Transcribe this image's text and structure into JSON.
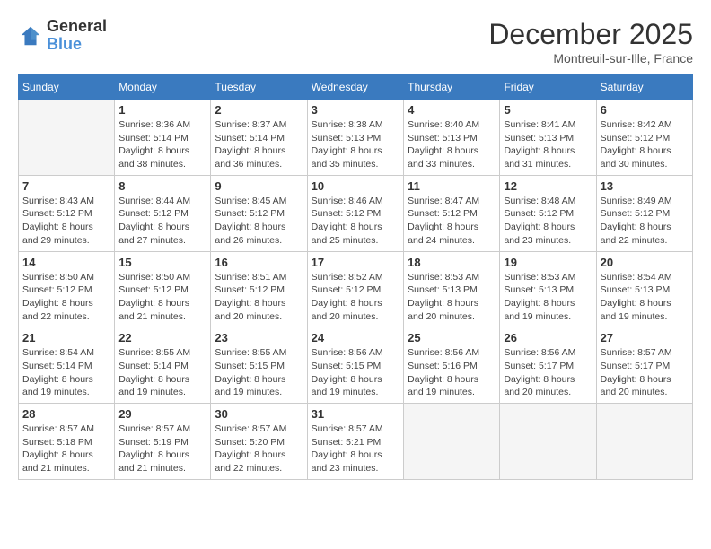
{
  "header": {
    "logo_general": "General",
    "logo_blue": "Blue",
    "month_year": "December 2025",
    "location": "Montreuil-sur-Ille, France"
  },
  "days_of_week": [
    "Sunday",
    "Monday",
    "Tuesday",
    "Wednesday",
    "Thursday",
    "Friday",
    "Saturday"
  ],
  "weeks": [
    [
      {
        "day": "",
        "sunrise": "",
        "sunset": "",
        "daylight": "",
        "empty": true
      },
      {
        "day": "1",
        "sunrise": "Sunrise: 8:36 AM",
        "sunset": "Sunset: 5:14 PM",
        "daylight": "Daylight: 8 hours and 38 minutes."
      },
      {
        "day": "2",
        "sunrise": "Sunrise: 8:37 AM",
        "sunset": "Sunset: 5:14 PM",
        "daylight": "Daylight: 8 hours and 36 minutes."
      },
      {
        "day": "3",
        "sunrise": "Sunrise: 8:38 AM",
        "sunset": "Sunset: 5:13 PM",
        "daylight": "Daylight: 8 hours and 35 minutes."
      },
      {
        "day": "4",
        "sunrise": "Sunrise: 8:40 AM",
        "sunset": "Sunset: 5:13 PM",
        "daylight": "Daylight: 8 hours and 33 minutes."
      },
      {
        "day": "5",
        "sunrise": "Sunrise: 8:41 AM",
        "sunset": "Sunset: 5:13 PM",
        "daylight": "Daylight: 8 hours and 31 minutes."
      },
      {
        "day": "6",
        "sunrise": "Sunrise: 8:42 AM",
        "sunset": "Sunset: 5:12 PM",
        "daylight": "Daylight: 8 hours and 30 minutes."
      }
    ],
    [
      {
        "day": "7",
        "sunrise": "Sunrise: 8:43 AM",
        "sunset": "Sunset: 5:12 PM",
        "daylight": "Daylight: 8 hours and 29 minutes."
      },
      {
        "day": "8",
        "sunrise": "Sunrise: 8:44 AM",
        "sunset": "Sunset: 5:12 PM",
        "daylight": "Daylight: 8 hours and 27 minutes."
      },
      {
        "day": "9",
        "sunrise": "Sunrise: 8:45 AM",
        "sunset": "Sunset: 5:12 PM",
        "daylight": "Daylight: 8 hours and 26 minutes."
      },
      {
        "day": "10",
        "sunrise": "Sunrise: 8:46 AM",
        "sunset": "Sunset: 5:12 PM",
        "daylight": "Daylight: 8 hours and 25 minutes."
      },
      {
        "day": "11",
        "sunrise": "Sunrise: 8:47 AM",
        "sunset": "Sunset: 5:12 PM",
        "daylight": "Daylight: 8 hours and 24 minutes."
      },
      {
        "day": "12",
        "sunrise": "Sunrise: 8:48 AM",
        "sunset": "Sunset: 5:12 PM",
        "daylight": "Daylight: 8 hours and 23 minutes."
      },
      {
        "day": "13",
        "sunrise": "Sunrise: 8:49 AM",
        "sunset": "Sunset: 5:12 PM",
        "daylight": "Daylight: 8 hours and 22 minutes."
      }
    ],
    [
      {
        "day": "14",
        "sunrise": "Sunrise: 8:50 AM",
        "sunset": "Sunset: 5:12 PM",
        "daylight": "Daylight: 8 hours and 22 minutes."
      },
      {
        "day": "15",
        "sunrise": "Sunrise: 8:50 AM",
        "sunset": "Sunset: 5:12 PM",
        "daylight": "Daylight: 8 hours and 21 minutes."
      },
      {
        "day": "16",
        "sunrise": "Sunrise: 8:51 AM",
        "sunset": "Sunset: 5:12 PM",
        "daylight": "Daylight: 8 hours and 20 minutes."
      },
      {
        "day": "17",
        "sunrise": "Sunrise: 8:52 AM",
        "sunset": "Sunset: 5:12 PM",
        "daylight": "Daylight: 8 hours and 20 minutes."
      },
      {
        "day": "18",
        "sunrise": "Sunrise: 8:53 AM",
        "sunset": "Sunset: 5:13 PM",
        "daylight": "Daylight: 8 hours and 20 minutes."
      },
      {
        "day": "19",
        "sunrise": "Sunrise: 8:53 AM",
        "sunset": "Sunset: 5:13 PM",
        "daylight": "Daylight: 8 hours and 19 minutes."
      },
      {
        "day": "20",
        "sunrise": "Sunrise: 8:54 AM",
        "sunset": "Sunset: 5:13 PM",
        "daylight": "Daylight: 8 hours and 19 minutes."
      }
    ],
    [
      {
        "day": "21",
        "sunrise": "Sunrise: 8:54 AM",
        "sunset": "Sunset: 5:14 PM",
        "daylight": "Daylight: 8 hours and 19 minutes."
      },
      {
        "day": "22",
        "sunrise": "Sunrise: 8:55 AM",
        "sunset": "Sunset: 5:14 PM",
        "daylight": "Daylight: 8 hours and 19 minutes."
      },
      {
        "day": "23",
        "sunrise": "Sunrise: 8:55 AM",
        "sunset": "Sunset: 5:15 PM",
        "daylight": "Daylight: 8 hours and 19 minutes."
      },
      {
        "day": "24",
        "sunrise": "Sunrise: 8:56 AM",
        "sunset": "Sunset: 5:15 PM",
        "daylight": "Daylight: 8 hours and 19 minutes."
      },
      {
        "day": "25",
        "sunrise": "Sunrise: 8:56 AM",
        "sunset": "Sunset: 5:16 PM",
        "daylight": "Daylight: 8 hours and 19 minutes."
      },
      {
        "day": "26",
        "sunrise": "Sunrise: 8:56 AM",
        "sunset": "Sunset: 5:17 PM",
        "daylight": "Daylight: 8 hours and 20 minutes."
      },
      {
        "day": "27",
        "sunrise": "Sunrise: 8:57 AM",
        "sunset": "Sunset: 5:17 PM",
        "daylight": "Daylight: 8 hours and 20 minutes."
      }
    ],
    [
      {
        "day": "28",
        "sunrise": "Sunrise: 8:57 AM",
        "sunset": "Sunset: 5:18 PM",
        "daylight": "Daylight: 8 hours and 21 minutes."
      },
      {
        "day": "29",
        "sunrise": "Sunrise: 8:57 AM",
        "sunset": "Sunset: 5:19 PM",
        "daylight": "Daylight: 8 hours and 21 minutes."
      },
      {
        "day": "30",
        "sunrise": "Sunrise: 8:57 AM",
        "sunset": "Sunset: 5:20 PM",
        "daylight": "Daylight: 8 hours and 22 minutes."
      },
      {
        "day": "31",
        "sunrise": "Sunrise: 8:57 AM",
        "sunset": "Sunset: 5:21 PM",
        "daylight": "Daylight: 8 hours and 23 minutes."
      },
      {
        "day": "",
        "sunrise": "",
        "sunset": "",
        "daylight": "",
        "empty": true
      },
      {
        "day": "",
        "sunrise": "",
        "sunset": "",
        "daylight": "",
        "empty": true
      },
      {
        "day": "",
        "sunrise": "",
        "sunset": "",
        "daylight": "",
        "empty": true
      }
    ]
  ]
}
